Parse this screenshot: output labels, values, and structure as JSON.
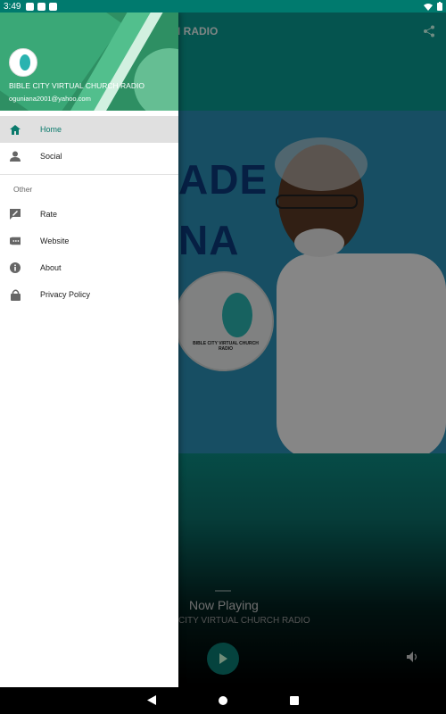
{
  "status_bar": {
    "time": "3:49"
  },
  "app": {
    "title": "CH RADIO",
    "artwork": {
      "line1": "ADE",
      "line2": "NA",
      "logo_text": "BIBLE CITY VIRTUAL CHURCH RADIO"
    },
    "now_playing_label": "Now Playing",
    "now_playing_station": "CITY VIRTUAL CHURCH RADIO",
    "colors": {
      "accent": "#0a9a90",
      "brand_green": "#2e8f63"
    }
  },
  "drawer": {
    "header_name": "BIBLE CITY VIRTUAL CHURCH RADIO",
    "header_email": "oguniana2001@yahoo.com",
    "main_items": [
      {
        "label": "Home",
        "icon": "home-icon"
      },
      {
        "label": "Social",
        "icon": "person-icon"
      }
    ],
    "section_title": "Other",
    "other_items": [
      {
        "label": "Rate",
        "icon": "rate-review-icon"
      },
      {
        "label": "Website",
        "icon": "website-icon"
      },
      {
        "label": "About",
        "icon": "info-icon"
      },
      {
        "label": "Privacy Policy",
        "icon": "lock-icon"
      }
    ]
  }
}
